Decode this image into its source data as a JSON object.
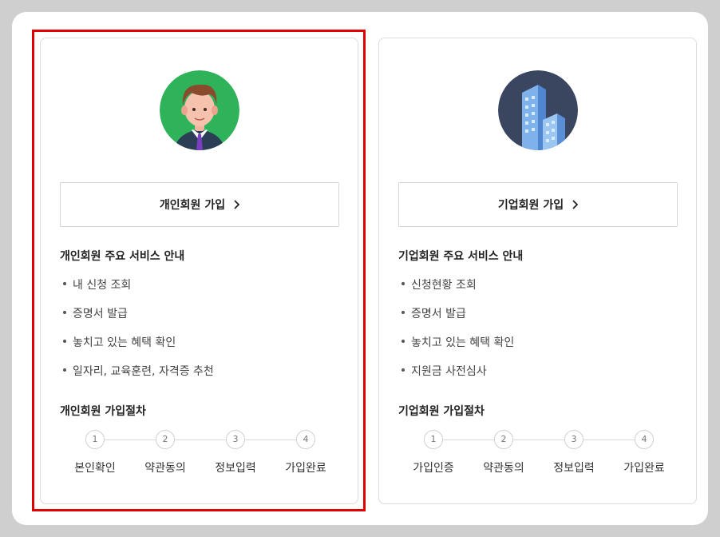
{
  "cards": [
    {
      "id": "personal",
      "join_label": "개인회원 가입",
      "services_title": "개인회원 주요 서비스 안내",
      "services": [
        "내 신청 조회",
        "증명서 발급",
        "놓치고 있는 혜택 확인",
        "일자리, 교육훈련, 자격증 추천"
      ],
      "process_title": "개인회원 가입절차",
      "steps": [
        {
          "num": "1",
          "label": "본인확인"
        },
        {
          "num": "2",
          "label": "약관동의"
        },
        {
          "num": "3",
          "label": "정보입력"
        },
        {
          "num": "4",
          "label": "가입완료"
        }
      ]
    },
    {
      "id": "corporate",
      "join_label": "기업회원 가입",
      "services_title": "기업회원 주요 서비스 안내",
      "services": [
        "신청현황 조회",
        "증명서 발급",
        "놓치고 있는 혜택 확인",
        "지원금 사전심사"
      ],
      "process_title": "기업회원 가입절차",
      "steps": [
        {
          "num": "1",
          "label": "가입인증"
        },
        {
          "num": "2",
          "label": "약관동의"
        },
        {
          "num": "3",
          "label": "정보입력"
        },
        {
          "num": "4",
          "label": "가입완료"
        }
      ]
    }
  ],
  "icons": {
    "personal_avatar": "person-avatar-icon",
    "corporate_avatar": "building-avatar-icon",
    "chevron": "chevron-right-icon"
  },
  "colors": {
    "highlight": "#e00000",
    "personal_bg": "#2fb35a",
    "corporate_bg": "#3a4560"
  }
}
